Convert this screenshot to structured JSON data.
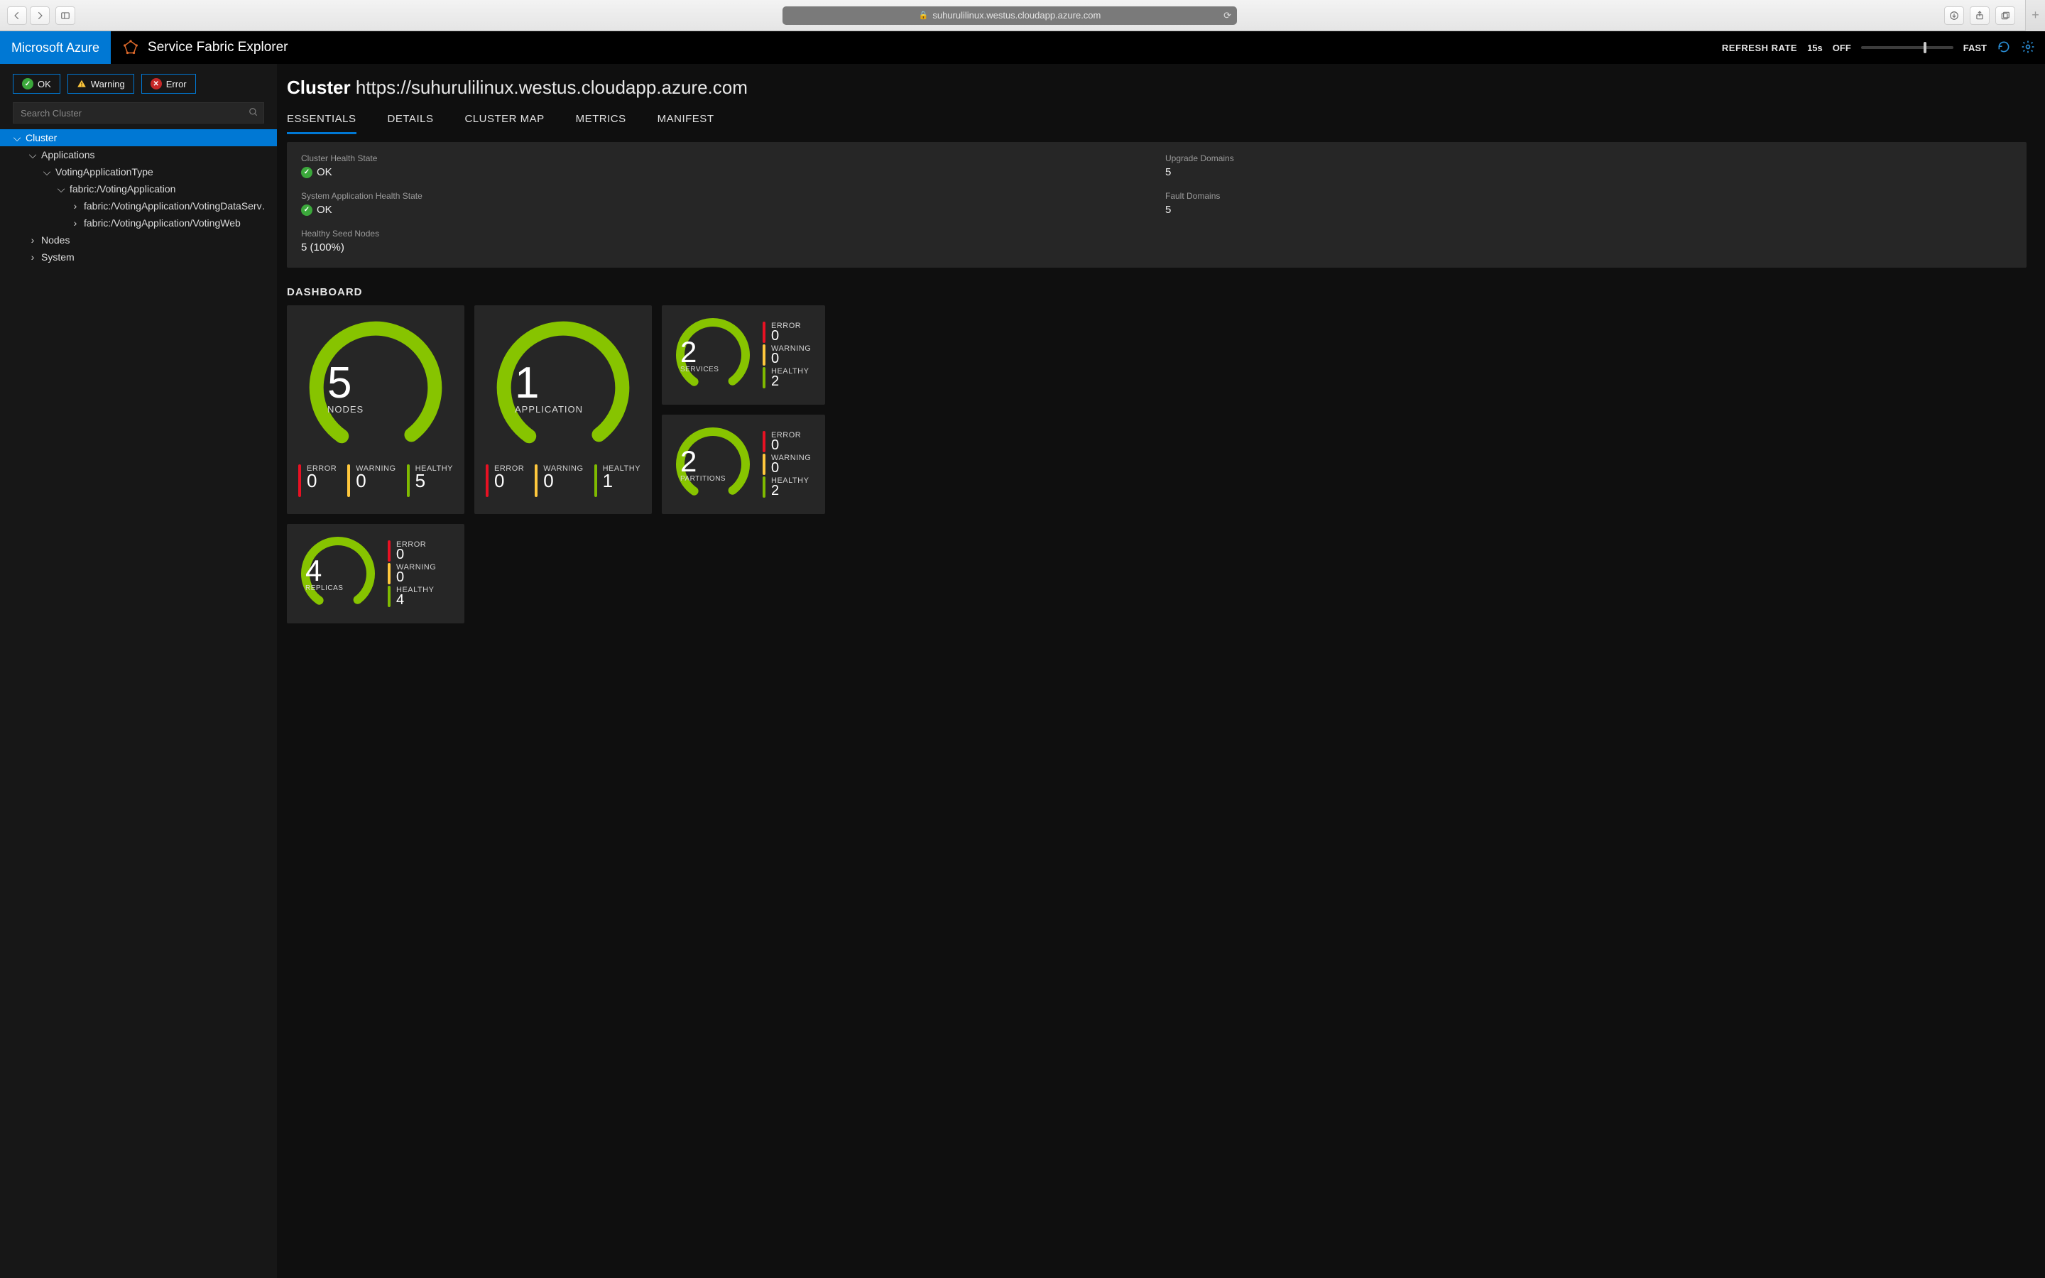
{
  "browser": {
    "address": "suhurulilinux.westus.cloudapp.azure.com"
  },
  "header": {
    "brand": "Microsoft Azure",
    "app_title": "Service Fabric Explorer",
    "refresh_label": "REFRESH RATE",
    "refresh_interval": "15s",
    "refresh_off": "OFF",
    "refresh_fast": "FAST"
  },
  "sidebar": {
    "filters": {
      "ok": "OK",
      "warning": "Warning",
      "error": "Error"
    },
    "search_placeholder": "Search Cluster",
    "tree": {
      "cluster": "Cluster",
      "applications": "Applications",
      "app_type": "VotingApplicationType",
      "app_instance": "fabric:/VotingApplication",
      "svc_data": "fabric:/VotingApplication/VotingDataServ…",
      "svc_web": "fabric:/VotingApplication/VotingWeb",
      "nodes": "Nodes",
      "system": "System"
    }
  },
  "page": {
    "title_prefix": "Cluster",
    "title_url": "https://suhurulilinux.westus.cloudapp.azure.com",
    "tabs": {
      "essentials": "ESSENTIALS",
      "details": "DETAILS",
      "cluster_map": "CLUSTER MAP",
      "metrics": "METRICS",
      "manifest": "MANIFEST"
    }
  },
  "essentials": {
    "cluster_health_label": "Cluster Health State",
    "cluster_health_value": "OK",
    "upgrade_domains_label": "Upgrade Domains",
    "upgrade_domains_value": "5",
    "sys_app_health_label": "System Application Health State",
    "sys_app_health_value": "OK",
    "fault_domains_label": "Fault Domains",
    "fault_domains_value": "5",
    "seed_nodes_label": "Healthy Seed Nodes",
    "seed_nodes_value": "5 (100%)"
  },
  "dashboard": {
    "heading": "DASHBOARD",
    "labels": {
      "error": "ERROR",
      "warning": "WARNING",
      "healthy": "HEALTHY"
    },
    "nodes": {
      "count": "5",
      "label": "NODES",
      "error": "0",
      "warning": "0",
      "healthy": "5"
    },
    "apps": {
      "count": "1",
      "label": "APPLICATION",
      "error": "0",
      "warning": "0",
      "healthy": "1"
    },
    "services": {
      "count": "2",
      "label": "SERVICES",
      "error": "0",
      "warning": "0",
      "healthy": "2"
    },
    "partitions": {
      "count": "2",
      "label": "PARTITIONS",
      "error": "0",
      "warning": "0",
      "healthy": "2"
    },
    "replicas": {
      "count": "4",
      "label": "REPLICAS",
      "error": "0",
      "warning": "0",
      "healthy": "4"
    }
  }
}
